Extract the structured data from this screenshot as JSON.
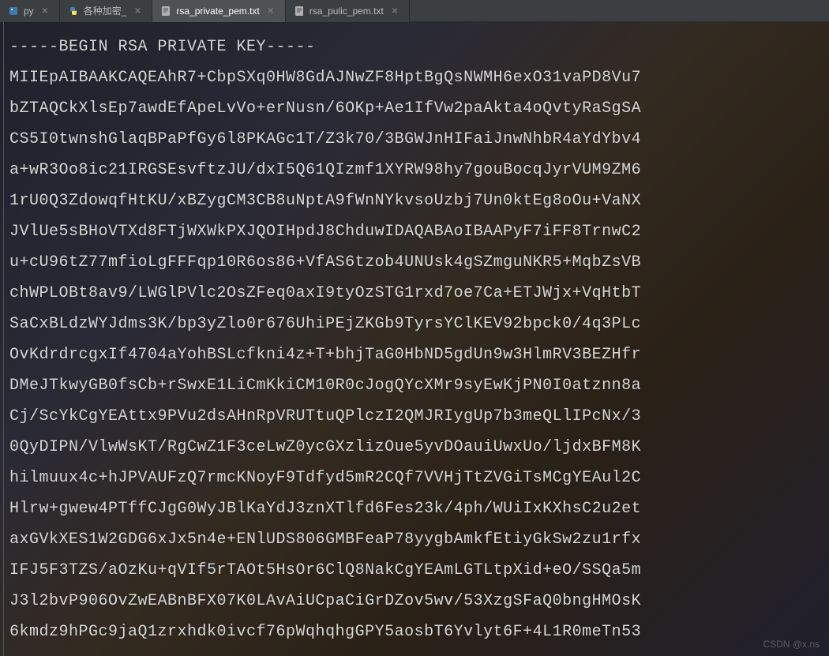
{
  "tabs": [
    {
      "label": "py",
      "type": "python"
    },
    {
      "label": "各种加密_",
      "type": "python"
    },
    {
      "label": "rsa_private_pem.txt",
      "type": "text",
      "active": true
    },
    {
      "label": "rsa_pulic_pem.txt",
      "type": "text"
    }
  ],
  "content": {
    "lines": [
      "-----BEGIN RSA PRIVATE KEY-----",
      "MIIEpAIBAAKCAQEAhR7+CbpSXq0HW8GdAJNwZF8HptBgQsNWMH6exO31vaPD8Vu7",
      "bZTAQCkXlsEp7awdEfApeLvVo+erNusn/6OKp+Ae1IfVw2paAkta4oQvtyRaSgSA",
      "CS5I0twnshGlaqBPaPfGy6l8PKAGc1T/Z3k70/3BGWJnHIFaiJnwNhbR4aYdYbv4",
      "a+wR3Oo8ic21IRGSEsvftzJU/dxI5Q61QIzmf1XYRW98hy7gouBocqJyrVUM9ZM6",
      "1rU0Q3ZdowqfHtKU/xBZygCM3CB8uNptA9fWnNYkvsoUzbj7Un0ktEg8oOu+VaNX",
      "JVlUe5sBHoVTXd8FTjWXWkPXJQOIHpdJ8ChduwIDAQABAoIBAAPyF7iFF8TrnwC2",
      "u+cU96tZ77mfioLgFFFqp10R6os86+VfAS6tzob4UNUsk4gSZmguNKR5+MqbZsVB",
      "chWPLOBt8av9/LWGlPVlc2OsZFeq0axI9tyOzSTG1rxd7oe7Ca+ETJWjx+VqHtbT",
      "SaCxBLdzWYJdms3K/bp3yZlo0r676UhiPEjZKGb9TyrsYClKEV92bpck0/4q3PLc",
      "OvKdrdrcgxIf4704aYohBSLcfkni4z+T+bhjTaG0HbND5gdUn9w3HlmRV3BEZHfr",
      "DMeJTkwyGB0fsCb+rSwxE1LiCmKkiCM10R0cJogQYcXMr9syEwKjPN0I0atznn8a",
      "Cj/ScYkCgYEAttx9PVu2dsAHnRpVRUTtuQPlczI2QMJRIygUp7b3meQLlIPcNx/3",
      "0QyDIPN/VlwWsKT/RgCwZ1F3ceLwZ0ycGXzlizOue5yvDOauiUwxUo/ljdxBFM8K",
      "hilmuux4c+hJPVAUFzQ7rmcKNoyF9Tdfyd5mR2CQf7VVHjTtZVGiTsMCgYEAul2C",
      "Hlrw+gwew4PTffCJgG0WyJBlKaYdJ3znXTlfd6Fes23k/4ph/WUiIxKXhsC2u2et",
      "axGVkXES1W2GDG6xJx5n4e+ENlUDS806GMBFeaP78yygbAmkfEtiyGkSw2zu1rfx",
      "IFJ5F3TZS/aOzKu+qVIf5rTAOt5HsOr6ClQ8NakCgYEAmLGTLtpXid+eO/SSQa5m",
      "J3l2bvP906OvZwEABnBFX07K0LAvAiUCpaCiGrDZov5wv/53XzgSFaQ0bngHMOsK",
      "6kmdz9hPGc9jaQ1zrxhdk0ivcf76pWqhqhgGPY5aosbT6Yvlyt6F+4L1R0meTn53"
    ]
  },
  "watermark": "CSDN @x.ns"
}
